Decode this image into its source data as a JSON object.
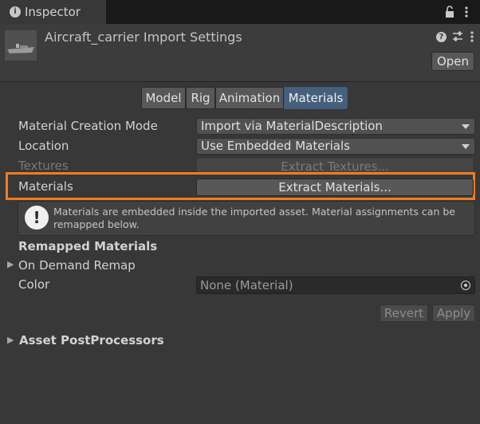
{
  "window": {
    "tab_title": "Inspector",
    "tab_icon": "info-icon"
  },
  "header": {
    "title": "Aircraft_carrier Import Settings",
    "open_label": "Open",
    "icons": [
      "help-icon",
      "preset-settings-icon",
      "more-menu-icon"
    ]
  },
  "toolbar": {
    "tabs": [
      {
        "label": "Model",
        "active": false
      },
      {
        "label": "Rig",
        "active": false
      },
      {
        "label": "Animation",
        "active": false
      },
      {
        "label": "Materials",
        "active": true
      }
    ]
  },
  "fields": {
    "creation_mode": {
      "label": "Material Creation Mode",
      "value": "Import via MaterialDescription"
    },
    "location": {
      "label": "Location",
      "value": "Use Embedded Materials"
    },
    "textures": {
      "label": "Textures",
      "button": "Extract Textures...",
      "enabled": false
    },
    "materials": {
      "label": "Materials",
      "button": "Extract Materials..."
    }
  },
  "helpbox": {
    "icon": "warning-icon",
    "text": "Materials are embedded inside the imported asset. Material assignments can be remapped below."
  },
  "remapped": {
    "heading": "Remapped Materials",
    "on_demand": "On Demand Remap",
    "color_label": "Color",
    "color_value": "None (Material)"
  },
  "actions": {
    "revert": "Revert",
    "apply": "Apply"
  },
  "postprocessors": {
    "heading": "Asset PostProcessors"
  },
  "colors": {
    "highlight": "#f47b20",
    "active_tab": "#46607c"
  }
}
